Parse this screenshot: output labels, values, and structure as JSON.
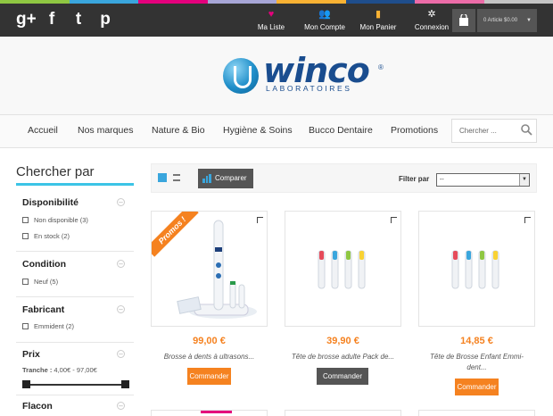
{
  "colors": {
    "top_stripe": [
      "#8fc742",
      "#3aa6dd",
      "#e4007c",
      "#a7a6d6",
      "#f9b233",
      "#1f4e8c",
      "#ec6ca8",
      "#c5c5c5"
    ],
    "accent": "#3cc4e6",
    "price": "#f58220",
    "topbar": "#333333"
  },
  "social": {
    "icons": [
      "google-plus-icon",
      "facebook-icon",
      "twitter-icon",
      "pinterest-icon"
    ],
    "glyphs": [
      "g+",
      "f",
      "t",
      "p"
    ]
  },
  "toplinks": [
    {
      "label": "Ma Liste",
      "icon": "heart-icon",
      "glyph": "♥",
      "color": "#e4007c"
    },
    {
      "label": "Mon Compte",
      "icon": "users-icon",
      "glyph": "👥",
      "color": "#3aa6dd"
    },
    {
      "label": "Mon Panier",
      "icon": "bag-icon",
      "glyph": "▮",
      "color": "#f9b233"
    },
    {
      "label": "Connexion",
      "icon": "gear-icon",
      "glyph": "✲",
      "color": "#ffffff"
    }
  ],
  "cart": {
    "label": "0 Article $0.00",
    "icon": "cart-icon"
  },
  "logo": {
    "word": "winco",
    "reg": "®",
    "subtitle": "LABORATOIRES"
  },
  "nav": [
    "Accueil",
    "Nos marques",
    "Nature & Bio",
    "Hygiène & Soins",
    "Bucco Dentaire",
    "Promotions"
  ],
  "search": {
    "placeholder": "Chercher ..."
  },
  "sidebar": {
    "title": "Chercher par",
    "filters": [
      {
        "title": "Disponibilité",
        "options": [
          "Non disponible (3)",
          "En stock (2)"
        ]
      },
      {
        "title": "Condition",
        "options": [
          "Neuf (5)"
        ]
      },
      {
        "title": "Fabricant",
        "options": [
          "Emmident (2)"
        ]
      },
      {
        "title": "Prix",
        "options": []
      },
      {
        "title": "Flacon",
        "options": []
      }
    ],
    "range_label": "Tranche :",
    "range_value": " 4,00€ - 97,00€",
    "range_fill": 1.0
  },
  "toolbar": {
    "compare": "Comparer",
    "filter_by": "Filter par",
    "filter_value": "--"
  },
  "products": [
    {
      "promo": "Promos !",
      "price": "99,00 €",
      "name": "Brosse à dents à ultrasons...",
      "button": "Commander"
    },
    {
      "promo": "",
      "price": "39,90 €",
      "name": "Tête de brosse adulte Pack de...",
      "button": "Commander"
    },
    {
      "promo": "",
      "price": "14,85 €",
      "name": "Tête de Brosse Enfant Emmi-dent...",
      "button": "Commander"
    }
  ]
}
